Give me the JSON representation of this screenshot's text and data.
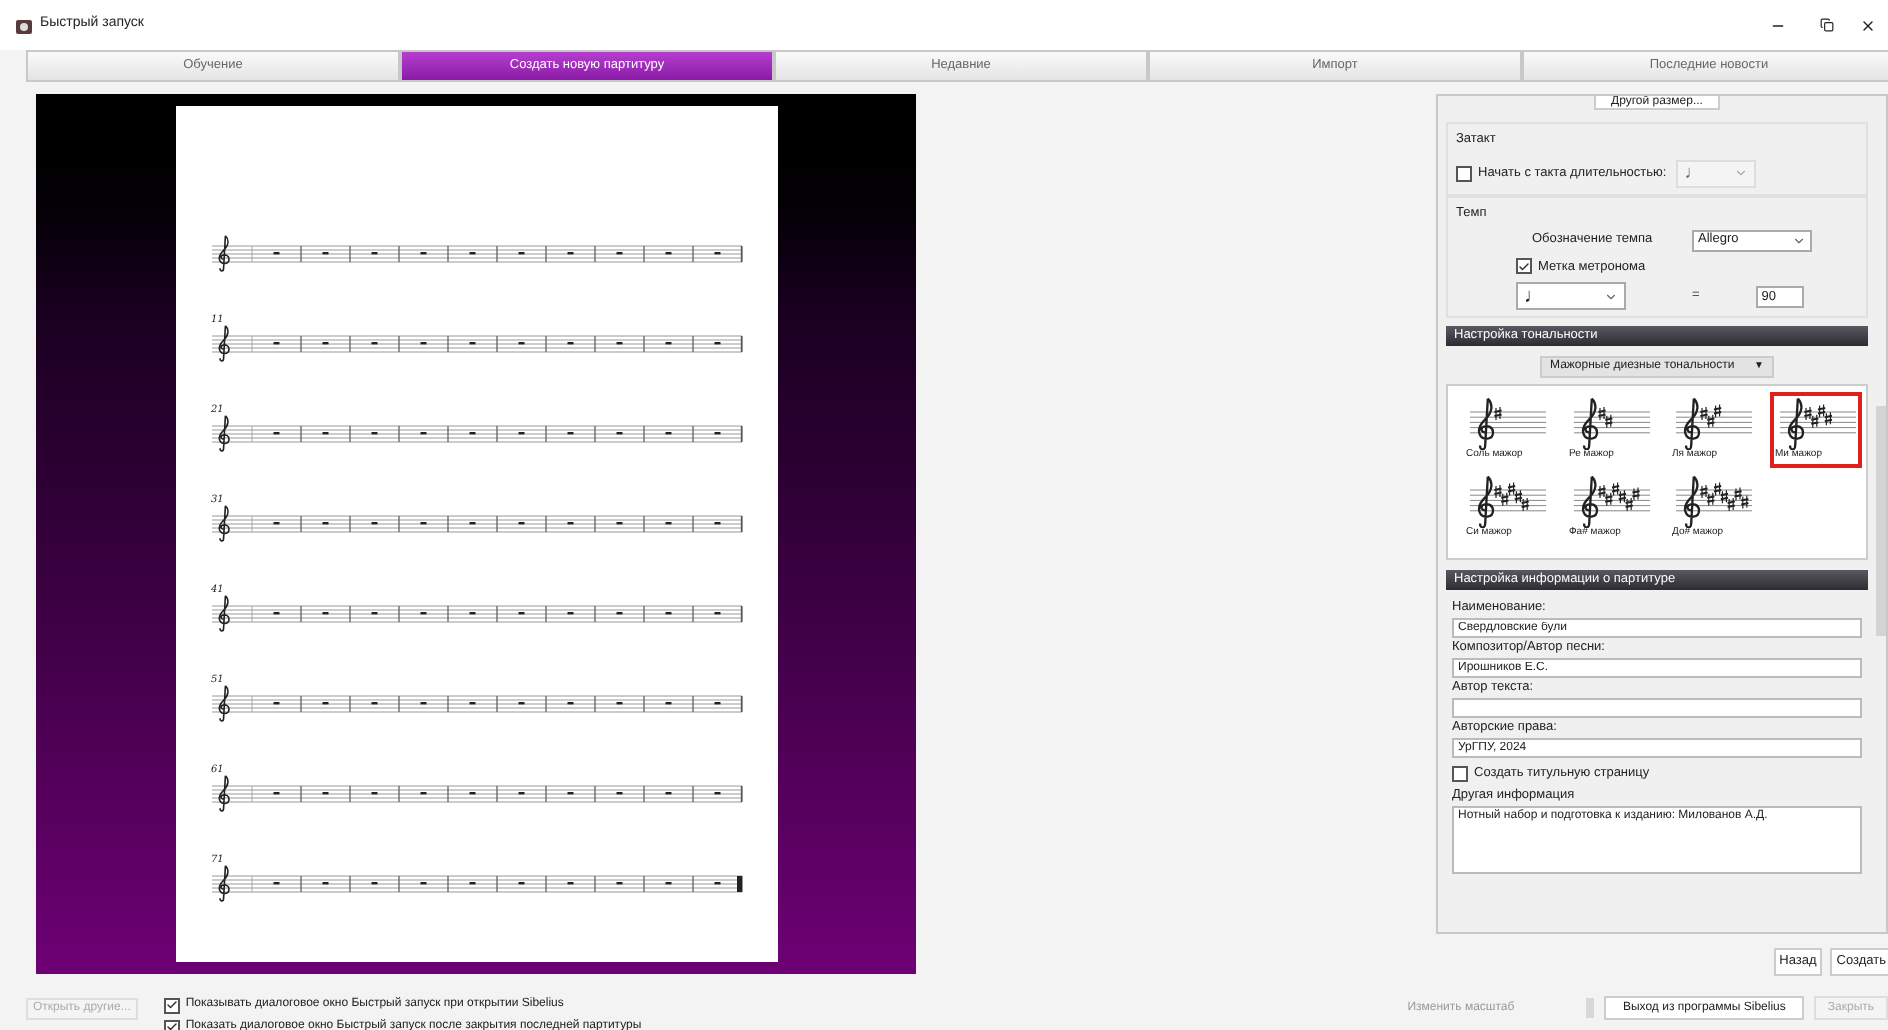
{
  "window": {
    "title": "Быстрый запуск"
  },
  "tabs": [
    {
      "label": "Обучение",
      "selected": false
    },
    {
      "label": "Создать новую партитуру",
      "selected": true
    },
    {
      "label": "Недавние",
      "selected": false
    },
    {
      "label": "Импорт",
      "selected": false
    },
    {
      "label": "Последние новости",
      "selected": false
    }
  ],
  "score": {
    "systems": [
      {
        "final_barline": false
      },
      {
        "measure_number": "11",
        "final_barline": false
      },
      {
        "measure_number": "21",
        "final_barline": false
      },
      {
        "measure_number": "31",
        "final_barline": false
      },
      {
        "measure_number": "41",
        "final_barline": false
      },
      {
        "measure_number": "51",
        "final_barline": false
      },
      {
        "measure_number": "61",
        "final_barline": false
      },
      {
        "measure_number": "71",
        "final_barline": true
      }
    ]
  },
  "panel": {
    "other_size_button": "Другой размер...",
    "pickup": {
      "title": "Затакт",
      "checkbox": {
        "label": "Начать с такта длительностью:",
        "checked": false
      },
      "duration": {
        "value": "♩",
        "disabled": true
      }
    },
    "tempo": {
      "title": "Темп",
      "marking_label": "Обозначение темпа",
      "marking_value": "Allegro",
      "metronome": {
        "label": "Метка метронома",
        "checked": true
      },
      "note_value": "♩",
      "equals": "=",
      "bpm": "90"
    },
    "key_section": {
      "header": "Настройка тональности",
      "category": "Мажорные диезные тональности",
      "category_arrow": "▼",
      "keys": [
        {
          "name": "Соль мажор",
          "selected": false
        },
        {
          "name": "Ре мажор",
          "selected": false
        },
        {
          "name": "Ля мажор",
          "selected": false
        },
        {
          "name": "Ми мажор",
          "selected": true
        },
        {
          "name": "Си мажор",
          "selected": false
        },
        {
          "name": "Фа# мажор",
          "selected": false
        },
        {
          "name": "До# мажор",
          "selected": false
        }
      ]
    },
    "info_section": {
      "header": "Настройка информации о партитуре",
      "fields": [
        {
          "label": "Наименование:",
          "value": "Свердловские були"
        },
        {
          "label": "Композитор/Автор песни:",
          "value": "Ирошников Е.С."
        },
        {
          "label": "Автор текста:"
        },
        {
          "label": "Авторские права:",
          "value": "УрГПУ, 2024"
        }
      ],
      "title_page": {
        "label": "Создать титульную страницу",
        "checked": false
      },
      "other_label": "Другая информация",
      "other_value": "Нотный набор и подготовка к изданию: Милованов А.Д."
    }
  },
  "nav_buttons": [
    {
      "label": "Назад",
      "disabled": false
    },
    {
      "label": "Создать",
      "disabled": false
    }
  ],
  "footer": {
    "open_other": {
      "label": "Открыть другие...",
      "disabled": true
    },
    "checkboxes": [
      {
        "label": "Показывать диалоговое окно Быстрый запуск при открытии Sibelius",
        "checked": true
      },
      {
        "label": "Показать диалоговое окно Быстрый запуск после закрытия последней партитуры",
        "checked": true
      }
    ],
    "zoom_label": "Изменить масштаб",
    "exit_button": {
      "label": "Выход из программы Sibelius",
      "disabled": false
    },
    "close_button": {
      "label": "Закрыть",
      "disabled": true
    }
  }
}
